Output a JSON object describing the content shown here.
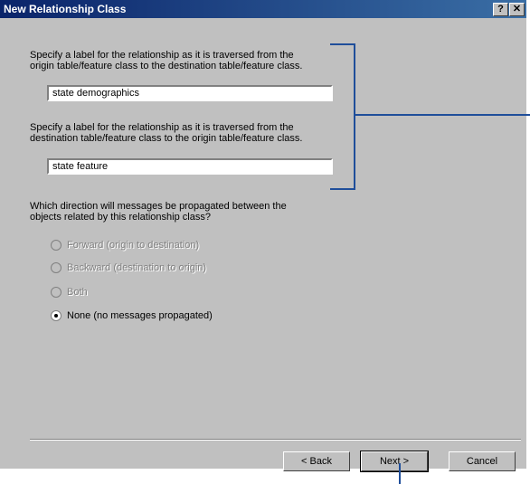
{
  "window": {
    "title": "New Relationship Class",
    "help_label": "?",
    "close_label": "✕"
  },
  "forward_label": {
    "prompt_line1": "Specify a label for the relationship as it is traversed from the",
    "prompt_line2": "origin table/feature class to the destination table/feature class.",
    "value": "state demographics"
  },
  "backward_label": {
    "prompt_line1": "Specify a label for the relationship as it is traversed from the",
    "prompt_line2": "destination table/feature class to the origin table/feature class.",
    "value": "state feature"
  },
  "propagation": {
    "prompt_line1": "Which direction will messages be propagated between the",
    "prompt_line2": "objects related by this relationship class?",
    "options": [
      {
        "label": "Forward (origin to destination)",
        "enabled": false,
        "checked": false
      },
      {
        "label": "Backward (destination to origin)",
        "enabled": false,
        "checked": false
      },
      {
        "label": "Both",
        "enabled": false,
        "checked": false
      },
      {
        "label": "None (no messages propagated)",
        "enabled": true,
        "checked": true
      }
    ]
  },
  "buttons": {
    "back": "< Back",
    "next": "Next >",
    "cancel": "Cancel"
  },
  "colors": {
    "dialog_face": "#c0c0c0",
    "titlebar_start": "#0a246a",
    "titlebar_end": "#3a6ea5",
    "callout": "#1f4e9a"
  }
}
